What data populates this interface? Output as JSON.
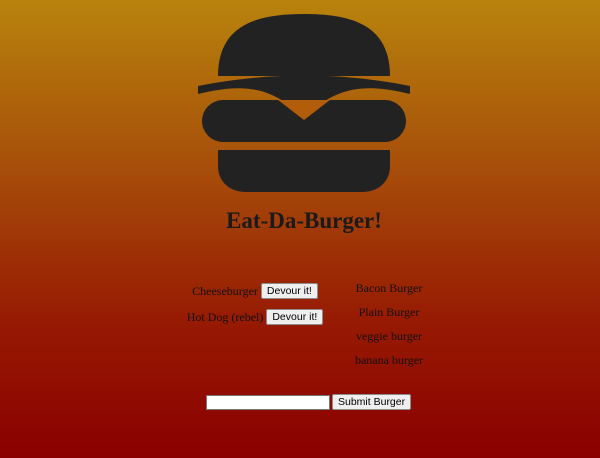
{
  "app": {
    "title": "Eat-Da-Burger!"
  },
  "logo": {
    "icon": "burger-icon",
    "color": "#222222"
  },
  "not_devoured": [
    {
      "name": "Cheeseburger",
      "button_label": "Devour it!"
    },
    {
      "name": "Hot Dog (rebel)",
      "button_label": "Devour it!"
    }
  ],
  "devoured": [
    {
      "name": "Bacon Burger"
    },
    {
      "name": "Plain Burger"
    },
    {
      "name": "veggie burger"
    },
    {
      "name": "banana burger"
    }
  ],
  "form": {
    "input_value": "",
    "placeholder": "",
    "submit_label": "Submit Burger"
  },
  "colors": {
    "gradient_top": "#b8830c",
    "gradient_bottom": "#8a0000"
  }
}
